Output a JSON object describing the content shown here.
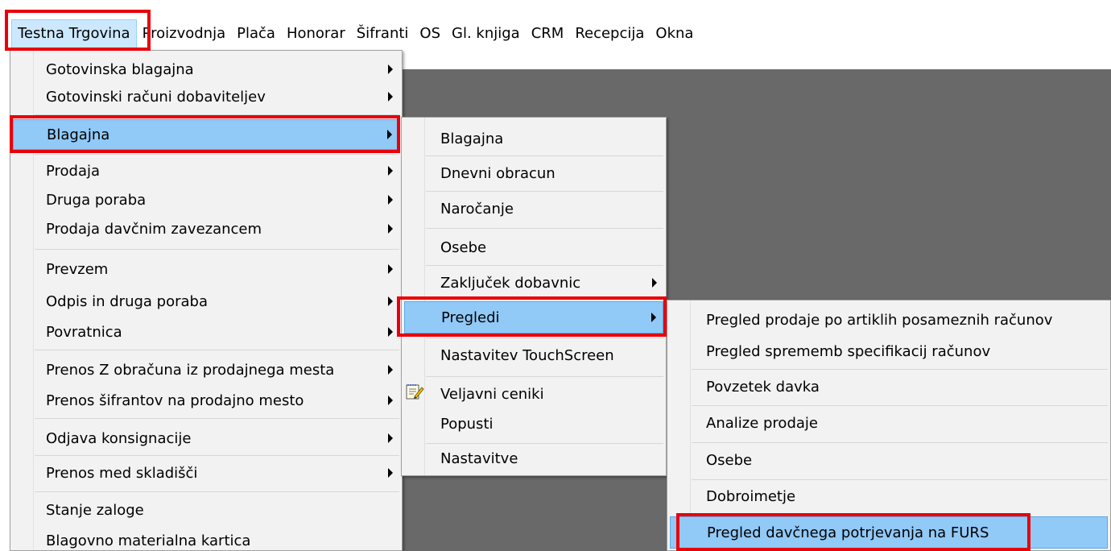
{
  "menubar": {
    "items": [
      {
        "label": "Testna Trgovina"
      },
      {
        "label": "Proizvodnja"
      },
      {
        "label": "Plača"
      },
      {
        "label": "Honorar"
      },
      {
        "label": "Šifranti"
      },
      {
        "label": "OS"
      },
      {
        "label": "Gl. knjiga"
      },
      {
        "label": "CRM"
      },
      {
        "label": "Recepcija"
      },
      {
        "label": "Okna"
      }
    ]
  },
  "menu1": {
    "items": [
      {
        "label": "Gotovinska blagajna",
        "submenu": true
      },
      {
        "label": "Gotovinski računi dobaviteljev",
        "submenu": true
      },
      {
        "label": "Blagajna",
        "submenu": true,
        "highlighted": true
      },
      {
        "label": "Prodaja",
        "submenu": true
      },
      {
        "label": "Druga poraba",
        "submenu": true
      },
      {
        "label": "Prodaja davčnim zavezancem",
        "submenu": true
      },
      {
        "label": "Prevzem",
        "submenu": true
      },
      {
        "label": "Odpis in druga poraba",
        "submenu": true
      },
      {
        "label": "Povratnica",
        "submenu": true
      },
      {
        "label": "Prenos Z obračuna iz prodajnega mesta",
        "submenu": true
      },
      {
        "label": "Prenos šifrantov na prodajno mesto",
        "submenu": true
      },
      {
        "label": "Odjava konsignacije",
        "submenu": true
      },
      {
        "label": "Prenos med skladišči",
        "submenu": true
      },
      {
        "label": "Stanje zaloge",
        "submenu": false
      },
      {
        "label": "Blagovno materialna kartica",
        "submenu": false
      }
    ]
  },
  "menu2": {
    "items": [
      {
        "label": "Blagajna",
        "submenu": false
      },
      {
        "label": "Dnevni obracun",
        "submenu": false
      },
      {
        "label": "Naročanje",
        "submenu": false
      },
      {
        "label": "Osebe",
        "submenu": false
      },
      {
        "label": "Zaključek dobavnic",
        "submenu": true
      },
      {
        "label": "Pregledi",
        "submenu": true,
        "highlighted": true
      },
      {
        "label": "Nastavitev TouchScreen",
        "submenu": false
      },
      {
        "label": "Veljavni ceniki",
        "submenu": false,
        "icon": "notepad-edit-icon"
      },
      {
        "label": "Popusti",
        "submenu": false
      },
      {
        "label": "Nastavitve",
        "submenu": false
      }
    ]
  },
  "menu3": {
    "items": [
      {
        "label": "Pregled prodaje po artiklih posameznih računov"
      },
      {
        "label": "Pregled sprememb specifikacij računov"
      },
      {
        "label": "Povzetek davka"
      },
      {
        "label": "Analize prodaje"
      },
      {
        "label": "Osebe"
      },
      {
        "label": "Dobroimetje"
      },
      {
        "label": "Pregled davčnega potrjevanja na FURS",
        "highlighted": true
      }
    ]
  },
  "colors": {
    "highlight": "#91c9f7",
    "annotation_red": "#e8000b",
    "workspace": "#696969",
    "menu_bg": "#f2f2f2"
  }
}
